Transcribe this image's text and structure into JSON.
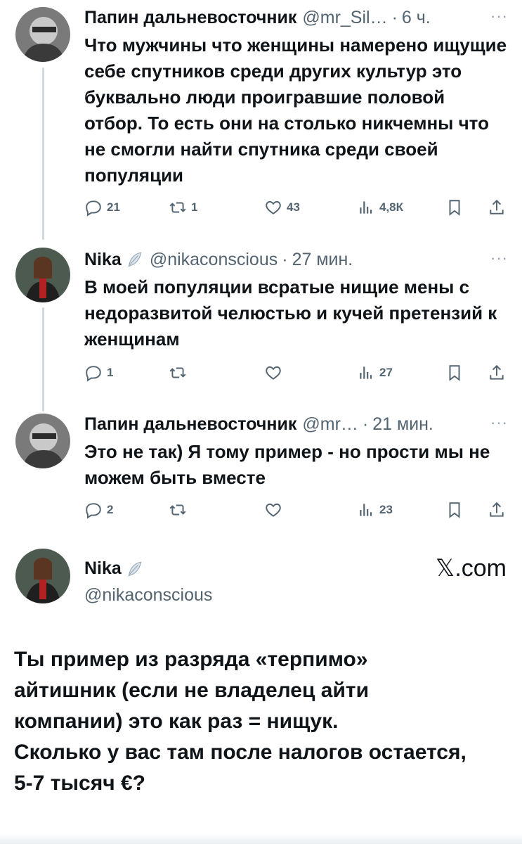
{
  "tweets": [
    {
      "name": "Папин дальневосточник",
      "handle": "@mr_Sil…",
      "time": "6 ч.",
      "text": "Что мужчины что женщины намерено ищущие себе спутников среди других культур это буквально люди проигравшие половой отбор. То есть они на столько никчемны что не смогли найти спутника среди своей популяции",
      "stats": {
        "replies": "21",
        "retweets": "1",
        "likes": "43",
        "views": "4,8К"
      }
    },
    {
      "name": "Nika",
      "handle": "@nikaconscious",
      "time": "27 мин.",
      "text": "В моей популяции всратые нищие мены с недоразвитой челюстью и кучей претензий к женщинам",
      "stats": {
        "replies": "1",
        "retweets": "",
        "likes": "",
        "views": "27"
      }
    },
    {
      "name": "Папин дальневосточник",
      "handle": "@mr…",
      "time": "21 мин.",
      "text": "Это не так) Я тому пример - но прости мы не можем быть вместе",
      "stats": {
        "replies": "2",
        "retweets": "",
        "likes": "",
        "views": "23"
      }
    }
  ],
  "main_tweet": {
    "name": "Nika",
    "handle": "@nikaconscious",
    "site": "𝕏.com",
    "text_lines": [
      "Ты пример из разряда «терпимо»",
      "айтишник (если не владелец айти",
      "компании) это как раз = нищук.",
      "Сколько у вас там после налогов остается,",
      "5-7 тысяч €?"
    ]
  },
  "dot": "·",
  "more_glyph": "···",
  "colors": {
    "text": "#0f1419",
    "muted": "#536471",
    "line": "#cfd9de"
  },
  "icons": [
    "reply-icon",
    "retweet-icon",
    "like-icon",
    "views-icon",
    "bookmark-icon",
    "share-icon",
    "verified-feather-icon"
  ]
}
